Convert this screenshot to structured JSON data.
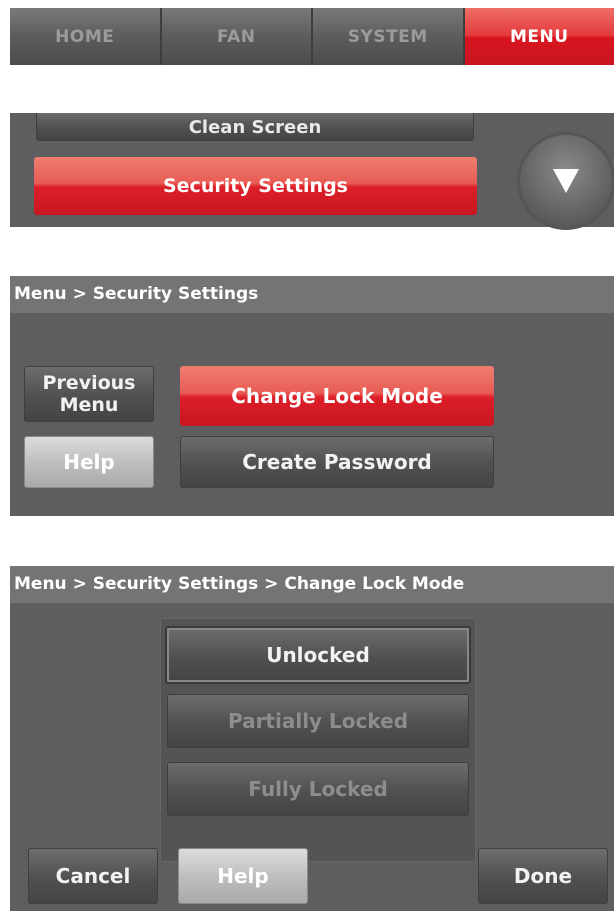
{
  "nav": {
    "tabs": [
      {
        "label": "HOME"
      },
      {
        "label": "FAN"
      },
      {
        "label": "SYSTEM"
      },
      {
        "label": "MENU"
      }
    ],
    "active_tab": "MENU"
  },
  "menu_list": {
    "items": [
      "Clean Screen",
      "Security Settings"
    ],
    "selected": "Security Settings",
    "scroll_icon": "triangle-down-icon"
  },
  "security_screen": {
    "breadcrumb": "Menu > Security Settings",
    "previous_menu_line1": "Previous",
    "previous_menu_line2": "Menu",
    "help_label": "Help",
    "change_lock_mode_label": "Change Lock Mode",
    "create_password_label": "Create Password"
  },
  "lock_mode_screen": {
    "breadcrumb": "Menu > Security Settings > Change Lock Mode",
    "options": [
      {
        "label": "Unlocked",
        "state": "selected"
      },
      {
        "label": "Partially Locked",
        "state": "unselected"
      },
      {
        "label": "Fully Locked",
        "state": "unselected"
      }
    ],
    "cancel_label": "Cancel",
    "help_label": "Help",
    "done_label": "Done"
  },
  "colors": {
    "accent_red": "#dd1f2a",
    "panel_gray": "#5e5e60",
    "breadcrumb_gray": "#747476"
  }
}
